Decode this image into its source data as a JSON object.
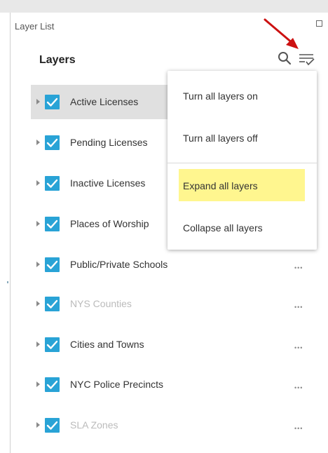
{
  "panel": {
    "title": "Layer List"
  },
  "widget": {
    "title": "Layers"
  },
  "layers": [
    {
      "label": "Active Licenses",
      "checked": true,
      "dimmed": false,
      "selected": true
    },
    {
      "label": "Pending Licenses",
      "checked": true,
      "dimmed": false,
      "selected": false
    },
    {
      "label": "Inactive Licenses",
      "checked": true,
      "dimmed": false,
      "selected": false
    },
    {
      "label": "Places of Worship",
      "checked": true,
      "dimmed": false,
      "selected": false
    },
    {
      "label": "Public/Private Schools",
      "checked": true,
      "dimmed": false,
      "selected": false
    },
    {
      "label": "NYS Counties",
      "checked": true,
      "dimmed": true,
      "selected": false
    },
    {
      "label": "Cities and Towns",
      "checked": true,
      "dimmed": false,
      "selected": false
    },
    {
      "label": "NYC Police Precincts",
      "checked": true,
      "dimmed": false,
      "selected": false
    },
    {
      "label": "SLA Zones",
      "checked": true,
      "dimmed": true,
      "selected": false
    }
  ],
  "menu": {
    "items": [
      "Turn all layers on",
      "Turn all layers off",
      "Expand all layers",
      "Collapse all layers"
    ],
    "highlighted": "Expand all layers"
  },
  "icons": {
    "search": "search-icon",
    "options": "layer-options-icon",
    "more": "more-options-icon",
    "maximize": "maximize-icon"
  },
  "colors": {
    "checkbox": "#29a3d6",
    "highlight": "#fff68f",
    "annotation_arrow": "#cc1111"
  }
}
